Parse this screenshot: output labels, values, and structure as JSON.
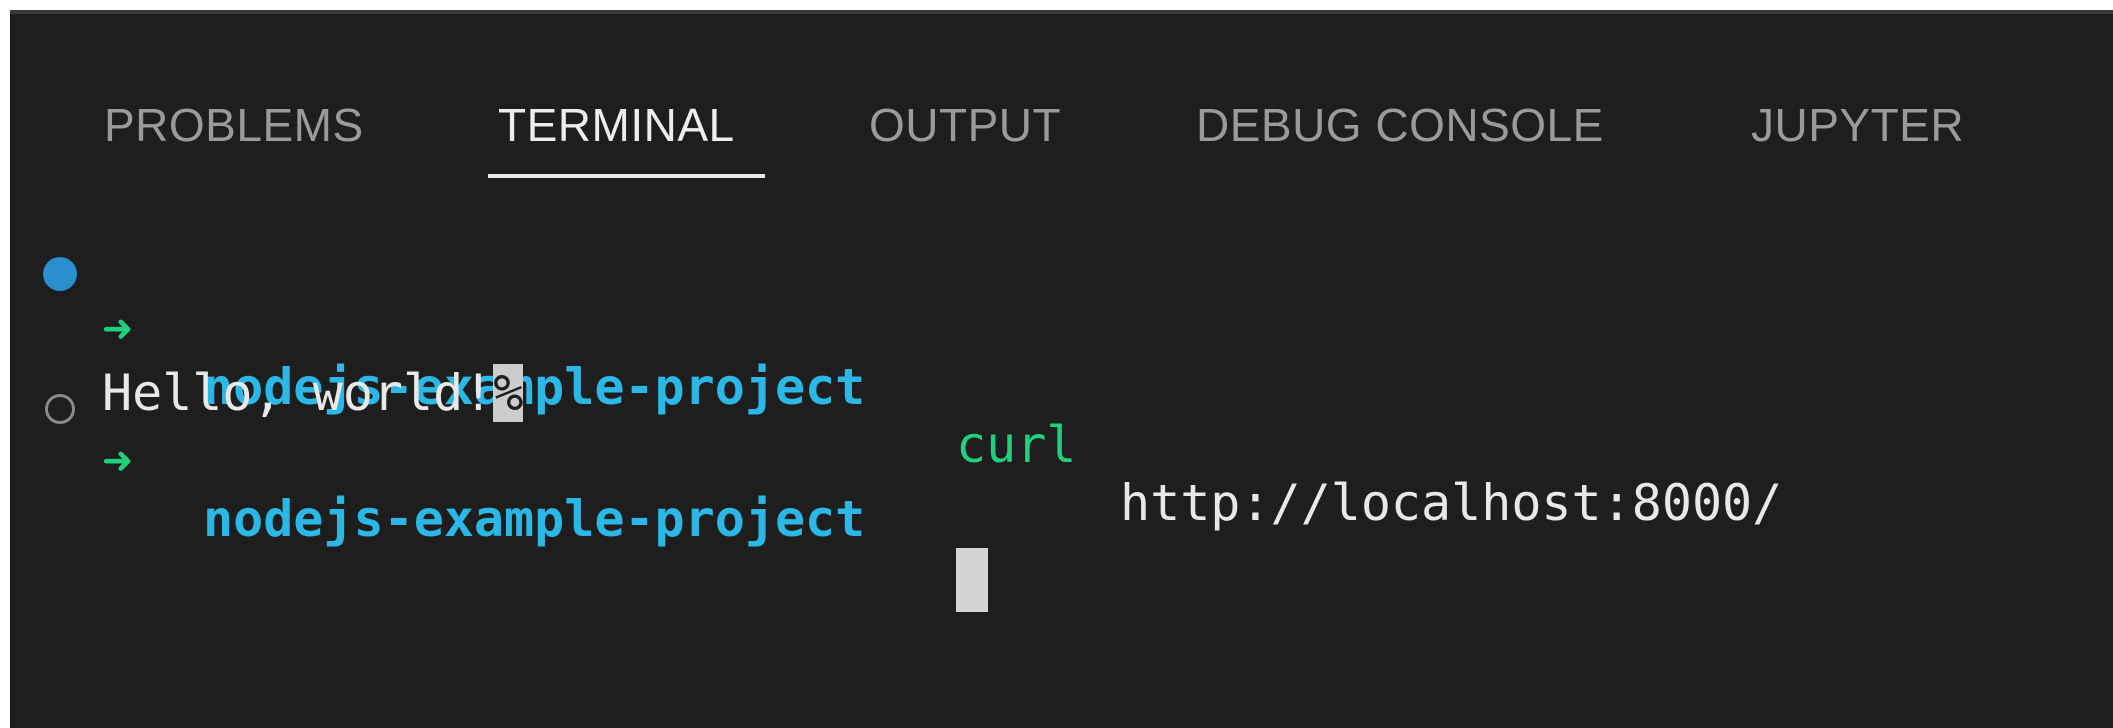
{
  "panel": {
    "tabs": [
      {
        "label": "PROBLEMS",
        "active": false
      },
      {
        "label": "TERMINAL",
        "active": true
      },
      {
        "label": "OUTPUT",
        "active": false
      },
      {
        "label": "DEBUG CONSOLE",
        "active": false
      },
      {
        "label": "JUPYTER",
        "active": false
      }
    ]
  },
  "terminal": {
    "lines": [
      {
        "type": "prompt",
        "status": "success",
        "arrow": "➜",
        "cwd": "nodejs-example-project",
        "command": "curl",
        "args": "http://localhost:8000/"
      },
      {
        "type": "output",
        "text": "Hello, world!",
        "end_marker": "%"
      },
      {
        "type": "prompt",
        "status": "pending",
        "arrow": "➜",
        "cwd": "nodejs-example-project"
      }
    ]
  },
  "colors": {
    "background": "#1e1e1e",
    "prompt_arrow": "#1fd17c",
    "cwd": "#2cb8e6",
    "command": "#1fd17c",
    "success_decoration": "#2a8fcd"
  }
}
